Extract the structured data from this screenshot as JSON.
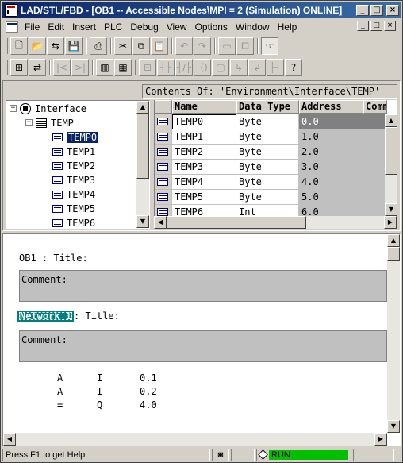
{
  "window": {
    "title": "LAD/STL/FBD  - [OB1 -- Accessible Nodes\\MPI = 2 (Simulation)  ONLINE]",
    "controls": [
      "_",
      "□",
      "×"
    ]
  },
  "menu": {
    "items": [
      "File",
      "Edit",
      "Insert",
      "PLC",
      "Debug",
      "View",
      "Options",
      "Window",
      "Help"
    ],
    "mdi_controls": [
      "_",
      "□",
      "×"
    ]
  },
  "toolbar1": {
    "buttons": [
      "new-icon",
      "open-icon",
      "online-icon",
      "save-icon",
      "print-icon",
      "cut-icon",
      "copy-icon",
      "paste-icon",
      "undo-icon",
      "redo-icon",
      "window-icon",
      "restore-icon",
      "pointer-icon"
    ]
  },
  "toolbar2": {
    "buttons": [
      "network-overview-icon",
      "monitor-icon",
      "breakpoint-prev-icon",
      "breakpoint-next-icon",
      "program-elements-icon",
      "details-icon",
      "new-network-icon",
      "no-contact-icon",
      "nc-contact-icon",
      "coil-icon",
      "empty-box-icon",
      "branch-open-icon",
      "branch-close-icon",
      "connection-icon",
      "help-context-icon"
    ]
  },
  "contents_header": "Contents Of: 'Environment\\Interface\\TEMP'",
  "tree": {
    "root": "Interface",
    "child": "TEMP",
    "root_toggle": "−",
    "child_toggle": "−",
    "vars": [
      "TEMP0",
      "TEMP1",
      "TEMP2",
      "TEMP3",
      "TEMP4",
      "TEMP5",
      "TEMP6"
    ],
    "selected": "TEMP0"
  },
  "grid": {
    "columns": [
      "Name",
      "Data Type",
      "Address",
      "Comment"
    ],
    "rows": [
      {
        "name": "TEMP0",
        "type": "Byte",
        "address": "0.0"
      },
      {
        "name": "TEMP1",
        "type": "Byte",
        "address": "1.0"
      },
      {
        "name": "TEMP2",
        "type": "Byte",
        "address": "2.0"
      },
      {
        "name": "TEMP3",
        "type": "Byte",
        "address": "3.0"
      },
      {
        "name": "TEMP4",
        "type": "Byte",
        "address": "4.0"
      },
      {
        "name": "TEMP5",
        "type": "Byte",
        "address": "5.0"
      },
      {
        "name": "TEMP6",
        "type": "Int",
        "address": "6.0"
      }
    ]
  },
  "editor": {
    "block_title": "OB1 : Title:",
    "comment_label": "Comment:",
    "network_label": "Network 1",
    "network_title": ": Title:",
    "network_comment_label": "Comment:",
    "statements": [
      {
        "op": "A",
        "area": "I",
        "addr": "0.1"
      },
      {
        "op": "A",
        "area": "I",
        "addr": "0.2"
      },
      {
        "op": "=",
        "area": "Q",
        "addr": "4.0"
      }
    ]
  },
  "status": {
    "help_text": "Press F1 to get Help.",
    "run_text": "RUN",
    "colors": {
      "run": "#00c000",
      "title_start": "#0a246a",
      "selection": "#0a246a",
      "network_label": "#008080"
    }
  }
}
